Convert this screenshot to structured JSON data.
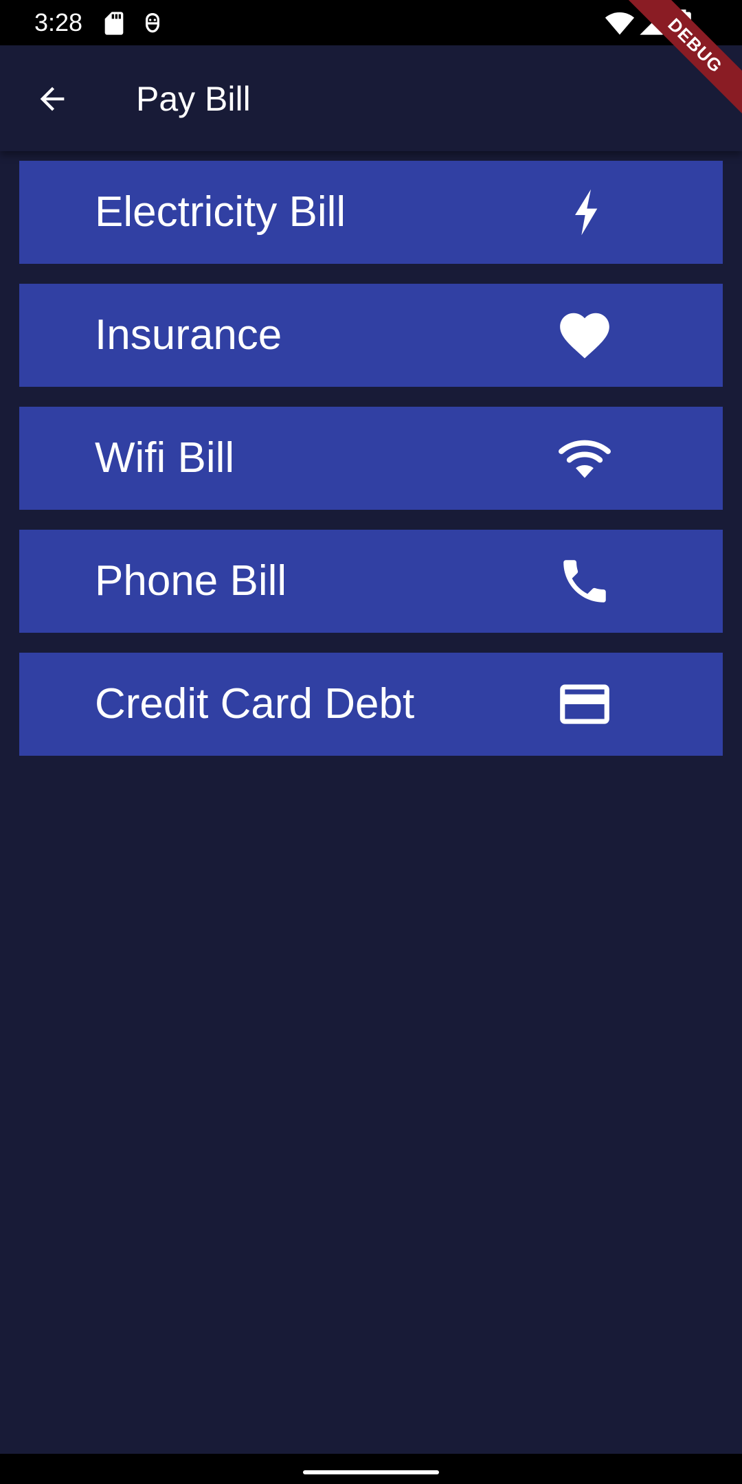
{
  "status_bar": {
    "time": "3:28",
    "left_icons": [
      "sd-card-icon",
      "android-debug-icon"
    ],
    "right_icons": [
      "wifi-signal-icon",
      "cell-signal-icon",
      "battery-icon"
    ]
  },
  "debug_banner": "DEBUG",
  "app_bar": {
    "back_icon": "arrow-back-icon",
    "title": "Pay Bill"
  },
  "bills": [
    {
      "label": "Electricity Bill",
      "icon": "flash-icon"
    },
    {
      "label": "Insurance",
      "icon": "heart-icon"
    },
    {
      "label": "Wifi Bill",
      "icon": "wifi-icon"
    },
    {
      "label": "Phone Bill",
      "icon": "phone-icon"
    },
    {
      "label": "Credit Card Debt",
      "icon": "credit-card-icon"
    }
  ],
  "colors": {
    "background": "#181b37",
    "tile": "#3140a3",
    "text": "#ffffff",
    "debug_ribbon": "#8a1c24"
  }
}
